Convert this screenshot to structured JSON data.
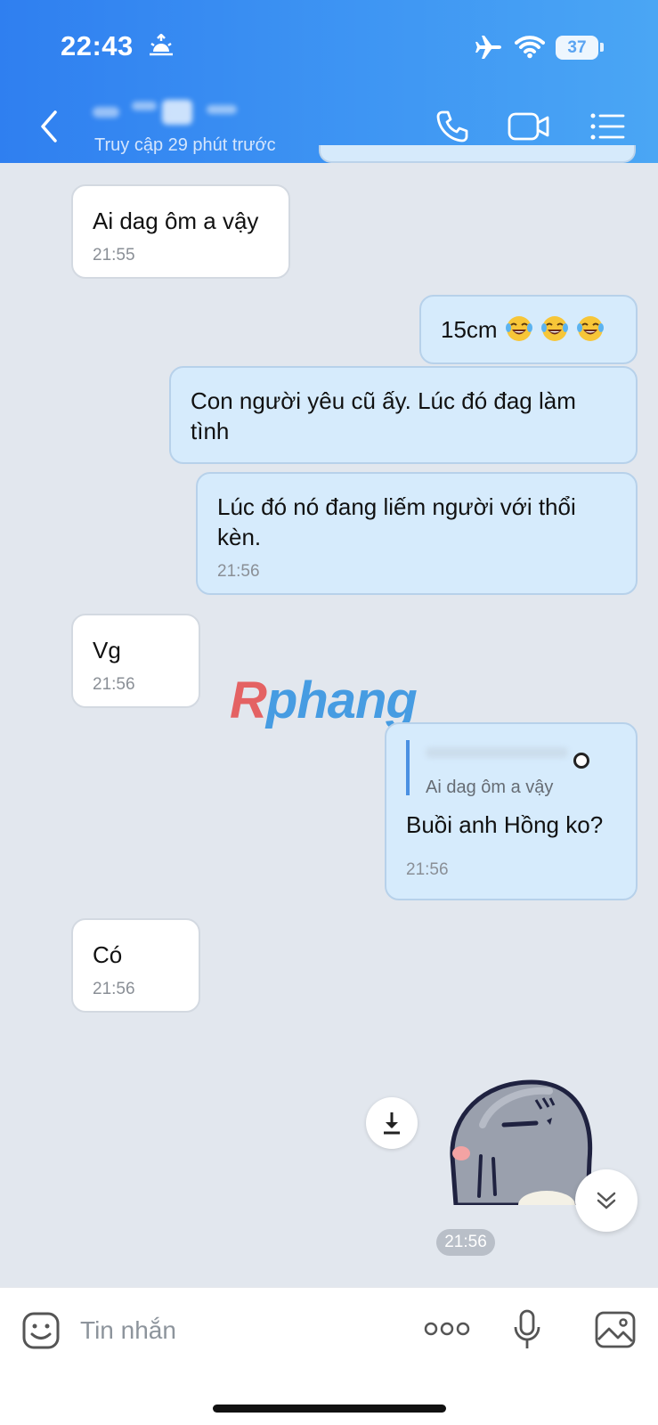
{
  "status_bar": {
    "time": "22:43",
    "battery": "37",
    "icons": [
      "sunrise-icon",
      "airplane-icon",
      "wifi-icon",
      "battery-icon"
    ]
  },
  "header": {
    "contact_status": "Truy cập 29 phút trước",
    "icons": [
      "back-icon",
      "phone-icon",
      "video-call-icon",
      "menu-icon"
    ],
    "background_colors": [
      "#2f7ff0",
      "#4aa6f4"
    ]
  },
  "messages": [
    {
      "direction": "in",
      "text": "Ai dag ôm a vậy",
      "time": "21:55"
    },
    {
      "direction": "out",
      "text": "15cm",
      "emoji": [
        "laughing-tears-emoji",
        "laughing-tears-emoji",
        "laughing-tears-emoji"
      ]
    },
    {
      "direction": "out",
      "text": "Con người yêu cũ ấy. Lúc đó đag làm tình"
    },
    {
      "direction": "out",
      "text": "Lúc đó nó đang liếm người với thổi kèn.",
      "time": "21:56"
    },
    {
      "direction": "in",
      "text": "Vg",
      "time": "21:56"
    },
    {
      "direction": "out",
      "quote": "Ai dag ôm a vậy",
      "text": "Buồi anh Hồng ko?",
      "time": "21:56"
    },
    {
      "direction": "in",
      "text": "Có",
      "time": "21:56"
    },
    {
      "direction": "out",
      "type": "sticker",
      "time": "21:56"
    }
  ],
  "watermark": "Rphang",
  "input": {
    "placeholder": "Tin nhắn",
    "icons": [
      "sticker-icon",
      "more-icon",
      "microphone-icon",
      "image-icon"
    ]
  },
  "colors": {
    "chat_background": "#e2e7ee",
    "outgoing_bubble": "#d6ebfc",
    "incoming_bubble": "#ffffff",
    "accent": "#2f7ff0"
  }
}
